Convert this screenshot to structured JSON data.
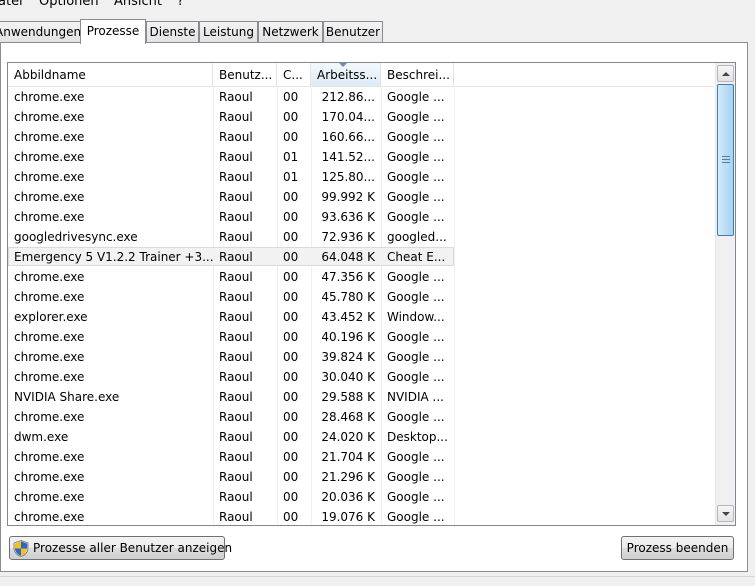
{
  "menubar": {
    "items": [
      "atei",
      "Optionen",
      "Ansicht",
      "?"
    ]
  },
  "tabs": [
    "Anwendungen",
    "Prozesse",
    "Dienste",
    "Leistung",
    "Netzwerk",
    "Benutzer"
  ],
  "active_tab": "Prozesse",
  "columns": [
    "Abbildname",
    "Benutz...",
    "C...",
    "Arbeitss...",
    "Beschrei..."
  ],
  "sorted_column": "Arbeitss...",
  "rows": [
    {
      "name": "chrome.exe",
      "user": "Raoul",
      "cpu": "00",
      "mem": "212.86...",
      "desc": "Google ..."
    },
    {
      "name": "chrome.exe",
      "user": "Raoul",
      "cpu": "00",
      "mem": "170.04...",
      "desc": "Google ..."
    },
    {
      "name": "chrome.exe",
      "user": "Raoul",
      "cpu": "00",
      "mem": "160.66...",
      "desc": "Google ..."
    },
    {
      "name": "chrome.exe",
      "user": "Raoul",
      "cpu": "01",
      "mem": "141.52...",
      "desc": "Google ..."
    },
    {
      "name": "chrome.exe",
      "user": "Raoul",
      "cpu": "01",
      "mem": "125.80...",
      "desc": "Google ..."
    },
    {
      "name": "chrome.exe",
      "user": "Raoul",
      "cpu": "00",
      "mem": "99.992 K",
      "desc": "Google ..."
    },
    {
      "name": "chrome.exe",
      "user": "Raoul",
      "cpu": "00",
      "mem": "93.636 K",
      "desc": "Google ..."
    },
    {
      "name": "googledrivesync.exe",
      "user": "Raoul",
      "cpu": "00",
      "mem": "72.936 K",
      "desc": "googled..."
    },
    {
      "name": "Emergency 5 V1.2.2 Trainer +3...",
      "user": "Raoul",
      "cpu": "00",
      "mem": "64.048 K",
      "desc": "Cheat E...",
      "selected": true
    },
    {
      "name": "chrome.exe",
      "user": "Raoul",
      "cpu": "00",
      "mem": "47.356 K",
      "desc": "Google ..."
    },
    {
      "name": "chrome.exe",
      "user": "Raoul",
      "cpu": "00",
      "mem": "45.780 K",
      "desc": "Google ..."
    },
    {
      "name": "explorer.exe",
      "user": "Raoul",
      "cpu": "00",
      "mem": "43.452 K",
      "desc": "Window..."
    },
    {
      "name": "chrome.exe",
      "user": "Raoul",
      "cpu": "00",
      "mem": "40.196 K",
      "desc": "Google ..."
    },
    {
      "name": "chrome.exe",
      "user": "Raoul",
      "cpu": "00",
      "mem": "39.824 K",
      "desc": "Google ..."
    },
    {
      "name": "chrome.exe",
      "user": "Raoul",
      "cpu": "00",
      "mem": "30.040 K",
      "desc": "Google ..."
    },
    {
      "name": "NVIDIA Share.exe",
      "user": "Raoul",
      "cpu": "00",
      "mem": "29.588 K",
      "desc": "NVIDIA ..."
    },
    {
      "name": "chrome.exe",
      "user": "Raoul",
      "cpu": "00",
      "mem": "28.468 K",
      "desc": "Google ..."
    },
    {
      "name": "dwm.exe",
      "user": "Raoul",
      "cpu": "00",
      "mem": "24.020 K",
      "desc": "Desktop..."
    },
    {
      "name": "chrome.exe",
      "user": "Raoul",
      "cpu": "00",
      "mem": "21.704 K",
      "desc": "Google ..."
    },
    {
      "name": "chrome.exe",
      "user": "Raoul",
      "cpu": "00",
      "mem": "21.296 K",
      "desc": "Google ..."
    },
    {
      "name": "chrome.exe",
      "user": "Raoul",
      "cpu": "00",
      "mem": "20.036 K",
      "desc": "Google ..."
    },
    {
      "name": "chrome.exe",
      "user": "Raoul",
      "cpu": "00",
      "mem": "19.076 K",
      "desc": "Google ..."
    }
  ],
  "buttons": {
    "show_all_users": "Prozesse aller Benutzer anzeigen",
    "end_process": "Prozess beenden"
  },
  "icons": {
    "uac_shield": "uac-shield-icon",
    "scroll_up": "scroll-up-arrow-icon",
    "scroll_down": "scroll-down-arrow-icon",
    "sort": "sort-descending-icon"
  },
  "colors": {
    "selection_bg": "#f2f2f2",
    "scroll_thumb": "#bcdcf4"
  }
}
